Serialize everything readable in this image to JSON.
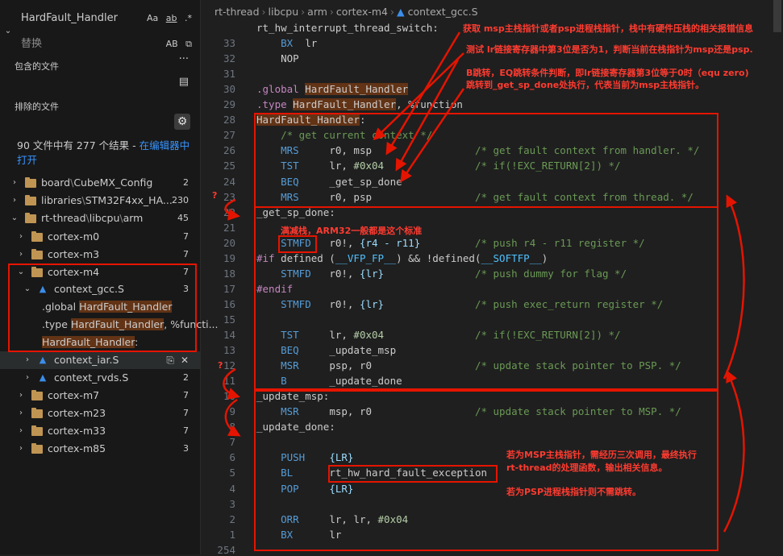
{
  "search": {
    "find_value": "HardFault_Handler",
    "find_options": [
      "Aa",
      "ab",
      ".*"
    ],
    "replace_placeholder": "替换",
    "replace_option": "AB",
    "files_to_include_label": "包含的文件",
    "files_to_exclude_label": "排除的文件",
    "results_message": "90 文件中有 277 个结果 - ",
    "results_link": "在编辑器中打开"
  },
  "tree": {
    "items": [
      {
        "label_a": "board",
        "label_b": "CubeMX_Config",
        "count": "2"
      },
      {
        "label_a": "libraries",
        "label_b": "STM32F4xx_HA...",
        "count": "230"
      },
      {
        "label_a": "rt-thread",
        "label_b": "libcpu",
        "label_c": "arm",
        "count": "45"
      },
      {
        "label": "cortex-m0",
        "count": "7"
      },
      {
        "label": "cortex-m3",
        "count": "7"
      },
      {
        "label": "cortex-m4",
        "count": "7"
      },
      {
        "label": "context_gcc.S",
        "count": "3"
      },
      {
        "pre": ".global ",
        "match": "HardFault_Handler",
        "post": ""
      },
      {
        "pre": ".type ",
        "match": "HardFault_Handler",
        "post": ", %functi..."
      },
      {
        "pre": "",
        "match": "HardFault_Handler",
        "post": ":"
      },
      {
        "label": "context_iar.S",
        "count": ""
      },
      {
        "label": "context_rvds.S",
        "count": "2"
      },
      {
        "label": "cortex-m7",
        "count": "7"
      },
      {
        "label": "cortex-m23",
        "count": "7"
      },
      {
        "label": "cortex-m33",
        "count": "7"
      },
      {
        "label": "cortex-m85",
        "count": "3"
      }
    ]
  },
  "breadcrumb": [
    "rt-thread",
    "libcpu",
    "arm",
    "cortex-m4",
    "context_gcc.S"
  ],
  "code_lines": [
    {
      "ln": "",
      "t": "rt_hw_interrupt_thread_switch:"
    },
    {
      "ln": "33",
      "t": "    BX  lr"
    },
    {
      "ln": "32",
      "t": "    NOP"
    },
    {
      "ln": "31",
      "t": ""
    },
    {
      "ln": "30",
      "t": ".global HardFault_Handler"
    },
    {
      "ln": "29",
      "t": ".type HardFault_Handler, %function"
    },
    {
      "ln": "28",
      "t": "HardFault_Handler:"
    },
    {
      "ln": "27",
      "t": "    /* get current context */"
    },
    {
      "ln": "26",
      "t": "    MRS     r0, msp                 /* get fault context from handler. */"
    },
    {
      "ln": "25",
      "t": "    TST     lr, #0x04               /* if(!EXC_RETURN[2]) */"
    },
    {
      "ln": "24",
      "t": "    BEQ     _get_sp_done"
    },
    {
      "ln": "23",
      "t": "    MRS     r0, psp                 /* get fault context from thread. */"
    },
    {
      "ln": "22",
      "t": "_get_sp_done:"
    },
    {
      "ln": "21",
      "t": ""
    },
    {
      "ln": "20",
      "t": "    STMFD   r0!, {r4 - r11}         /* push r4 - r11 register */"
    },
    {
      "ln": "19",
      "t": "#if defined (__VFP_FP__) && !defined(__SOFTFP__)"
    },
    {
      "ln": "18",
      "t": "    STMFD   r0!, {lr}               /* push dummy for flag */"
    },
    {
      "ln": "17",
      "t": "#endif"
    },
    {
      "ln": "16",
      "t": "    STMFD   r0!, {lr}               /* push exec_return register */"
    },
    {
      "ln": "15",
      "t": ""
    },
    {
      "ln": "14",
      "t": "    TST     lr, #0x04               /* if(!EXC_RETURN[2]) */"
    },
    {
      "ln": "13",
      "t": "    BEQ     _update_msp"
    },
    {
      "ln": "12",
      "t": "    MSR     psp, r0                 /* update stack pointer to PSP. */"
    },
    {
      "ln": "11",
      "t": "    B       _update_done"
    },
    {
      "ln": "10",
      "t": "_update_msp:"
    },
    {
      "ln": "9",
      "t": "    MSR     msp, r0                 /* update stack pointer to MSP. */"
    },
    {
      "ln": "8",
      "t": "_update_done:"
    },
    {
      "ln": "7",
      "t": ""
    },
    {
      "ln": "6",
      "t": "    PUSH    {LR}"
    },
    {
      "ln": "5",
      "t": "    BL      rt_hw_hard_fault_exception"
    },
    {
      "ln": "4",
      "t": "    POP     {LR}"
    },
    {
      "ln": "3",
      "t": ""
    },
    {
      "ln": "2",
      "t": "    ORR     lr, lr, #0x04"
    },
    {
      "ln": "1",
      "t": "    BX      lr"
    },
    {
      "ln": "254",
      "t": ""
    }
  ],
  "annotations": {
    "a1": "获取 msp主栈指针或者psp进程栈指针，栈中有硬件压栈的相关报错信息",
    "a2": "测试 lr链接寄存器中第3位是否为1，判断当前在栈指针为msp还是psp.",
    "a3": "B跳转，EQ跳转条件判断，即lr链接寄存器第3位等于0时（equ zero)",
    "a4": "跳转到_get_sp_done处执行，代表当前为msp主栈指针。",
    "a5": "满减栈，ARM32一般都是这个标准",
    "a6": "若为MSP主栈指针，需经历三次调用，最终执行",
    "a7": "rt-thread的处理函数，输出相关信息。",
    "a8": "若为PSP进程栈指针则不需跳转。",
    "q1": "?",
    "q2": "?"
  },
  "colors": {
    "annotation": "#ff3b30",
    "match_highlight": "#623315",
    "accent": "#3794ff"
  }
}
